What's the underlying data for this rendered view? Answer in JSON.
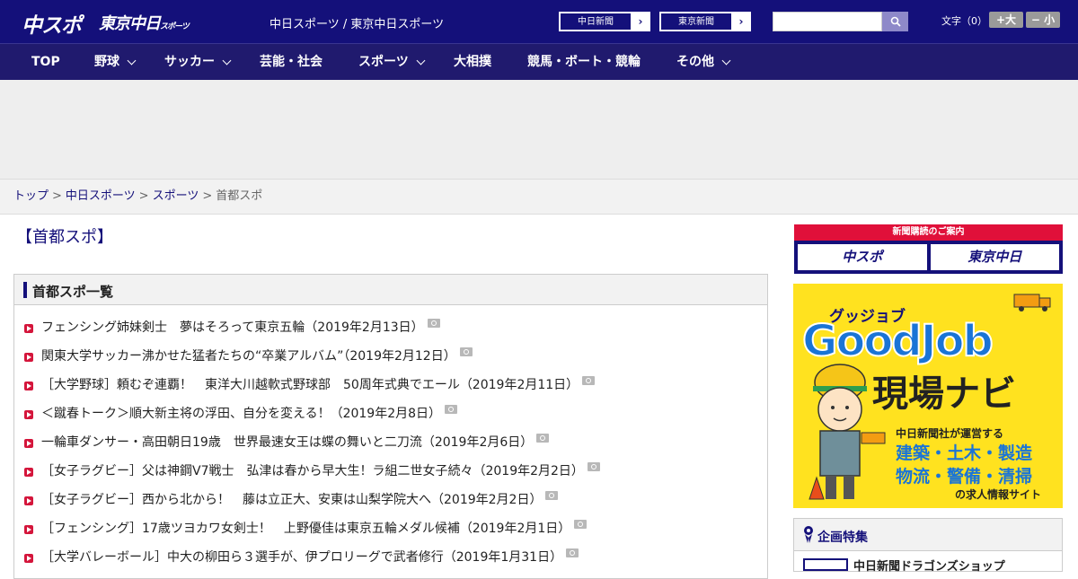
{
  "header": {
    "logo_chuspo": "中スポ",
    "logo_tokyo": "東京中日",
    "logo_tokyo_sub": "スポーツ",
    "site_title": "中日スポーツ / 東京中日スポーツ",
    "paper_buttons": [
      {
        "label": "中日新聞",
        "arrow": "›"
      },
      {
        "label": "東京新聞",
        "arrow": "›"
      }
    ],
    "search": {
      "value": "",
      "placeholder": ""
    },
    "font_size": {
      "label": "文字（0）",
      "bigger": "+大",
      "smaller": "− 小"
    }
  },
  "nav": {
    "items": [
      {
        "label": "TOP",
        "has_menu": false
      },
      {
        "label": "野球",
        "has_menu": true
      },
      {
        "label": "サッカー",
        "has_menu": true
      },
      {
        "label": "芸能・社会",
        "has_menu": false
      },
      {
        "label": "スポーツ",
        "has_menu": true
      },
      {
        "label": "大相撲",
        "has_menu": false
      },
      {
        "label": "競馬・ボート・競輪",
        "has_menu": false
      },
      {
        "label": "その他",
        "has_menu": true
      }
    ]
  },
  "breadcrumb": {
    "items": [
      "トップ",
      "中日スポーツ",
      "スポーツ",
      "首都スポ"
    ],
    "separator": ">"
  },
  "page": {
    "title": "【首都スポ】"
  },
  "list": {
    "heading": "首都スポ一覧",
    "articles": [
      "フェンシング姉妹剣士　夢はそろって東京五輪（2019年2月13日）",
      "関東大学サッカー沸かせた猛者たちの“卒業アルバム”（2019年2月12日）",
      "［大学野球］頼むぞ連覇！　東洋大川越軟式野球部　50周年式典でエール（2019年2月11日）",
      "＜蹴春トーク＞順大新主将の浮田、自分を変える！（2019年2月8日）",
      "一輪車ダンサー・高田朝日19歳　世界最速女王は蝶の舞いと二刀流（2019年2月6日）",
      "［女子ラグビー］父は神鋼V7戦士　弘津は春から早大生！ラ組二世女子続々（2019年2月2日）",
      "［女子ラグビー］西から北から！　藤は立正大、安東は山梨学院大へ（2019年2月2日）",
      "［フェンシング］17歳ツヨカワ女剣士！　上野優佳は東京五輪メダル候補（2019年2月1日）",
      "［大学バレーボール］中大の柳田ら３選手が、伊プロリーグで武者修行（2019年1月31日）"
    ]
  },
  "sidebar": {
    "subscription": {
      "heading": "新聞購読のご案内",
      "logos": [
        "中スポ",
        "東京中日"
      ]
    },
    "job_ad": {
      "kana": "グッジョブ",
      "brand": "GoodJob",
      "name": "現場ナビ",
      "line1": "中日新聞社が運営する",
      "line2": "建築・土木・製造",
      "line3": "物流・警備・清掃",
      "line4": "の求人情報サイト"
    },
    "feature": {
      "heading": "企画特集",
      "item": "中日新聞ドラゴンズショップ"
    }
  },
  "colors": {
    "brand_navy": "#14107a",
    "accent_red": "#d4153b",
    "ad_yellow": "#ffe21f",
    "ad_blue": "#1a74d6"
  }
}
